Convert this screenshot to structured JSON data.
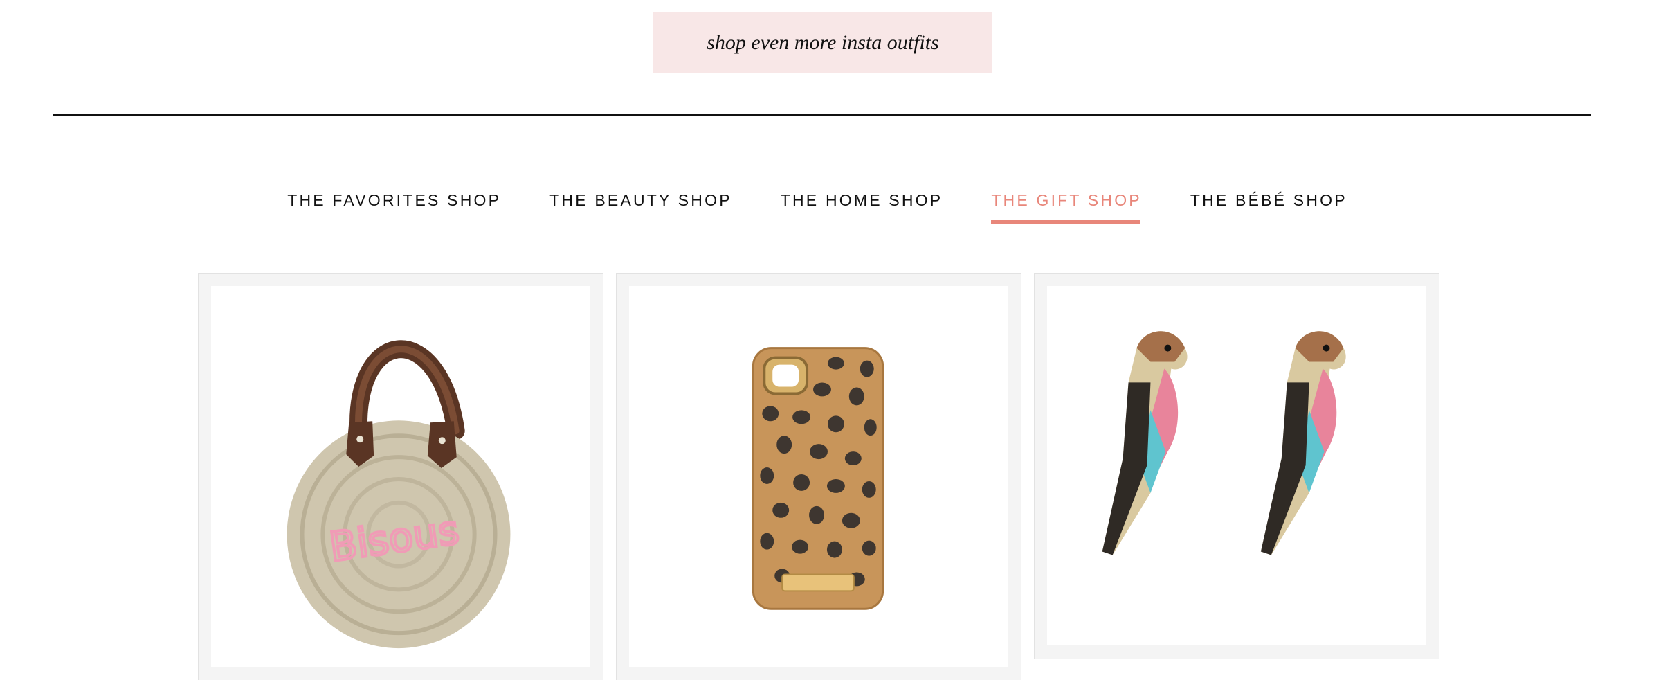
{
  "cta": {
    "label": "shop even more insta outfits"
  },
  "shop_nav": {
    "tabs": [
      {
        "label": "THE FAVORITES SHOP",
        "active": false
      },
      {
        "label": "THE BEAUTY SHOP",
        "active": false
      },
      {
        "label": "THE HOME SHOP",
        "active": false
      },
      {
        "label": "THE GIFT SHOP",
        "active": true
      },
      {
        "label": "THE BÉBÉ SHOP",
        "active": false
      }
    ]
  },
  "products": [
    {
      "name": "straw-basket-bag",
      "image_text": "Bisous"
    },
    {
      "name": "leopard-phone-case"
    },
    {
      "name": "parrot-earrings"
    }
  ],
  "colors": {
    "cta_background": "#f8e7e7",
    "active_tab": "#e8867a",
    "divider": "#111111",
    "card_border": "#f4f4f4"
  }
}
